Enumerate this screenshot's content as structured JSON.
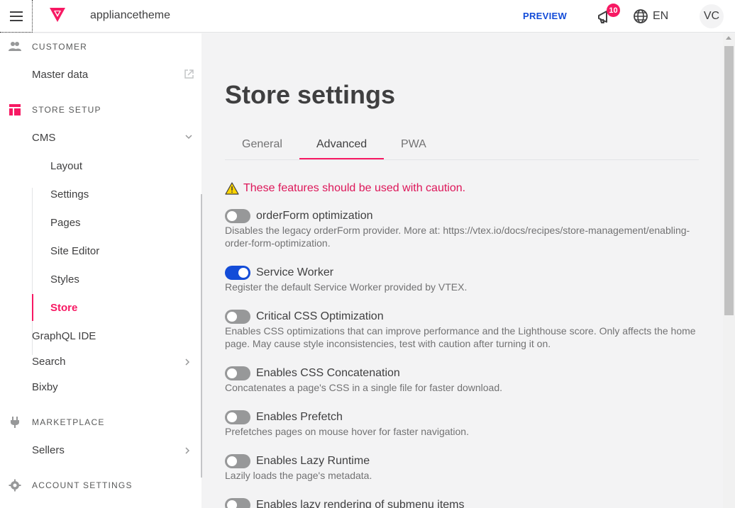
{
  "header": {
    "account_name": "appliancetheme",
    "preview_label": "PREVIEW",
    "notifications_count": "10",
    "language": "EN",
    "user_initials": "VC",
    "brand_color": "#f71963"
  },
  "sidebar": {
    "sections": {
      "customer": {
        "label": "CUSTOMER",
        "icon": "users-icon"
      },
      "store_setup": {
        "label": "STORE SETUP",
        "icon": "layout-icon"
      },
      "marketplace": {
        "label": "MARKETPLACE",
        "icon": "plug-icon"
      },
      "account_settings": {
        "label": "ACCOUNT SETTINGS",
        "icon": "gear-icon"
      }
    },
    "items": {
      "master_data": "Master data",
      "cms": "CMS",
      "graphql_ide": "GraphQL IDE",
      "search": "Search",
      "bixby": "Bixby",
      "sellers": "Sellers"
    },
    "cms_sub_items": [
      "Layout",
      "Settings",
      "Pages",
      "Site Editor",
      "Styles",
      "Store"
    ],
    "active_item": "Store"
  },
  "main": {
    "title": "Store settings",
    "tabs": [
      "General",
      "Advanced",
      "PWA"
    ],
    "active_tab": "Advanced",
    "warning": "These features should be used with caution.",
    "options": [
      {
        "title": "orderForm optimization",
        "enabled": false,
        "description": "Disables the legacy orderForm provider. More at: https://vtex.io/docs/recipes/store-management/enabling-order-form-optimization."
      },
      {
        "title": "Service Worker",
        "enabled": true,
        "description": "Register the default Service Worker provided by VTEX."
      },
      {
        "title": "Critical CSS Optimization",
        "enabled": false,
        "description": "Enables CSS optimizations that can improve performance and the Lighthouse score. Only affects the home page. May cause style inconsistencies, test with caution after turning it on."
      },
      {
        "title": "Enables CSS Concatenation",
        "enabled": false,
        "description": "Concatenates a page's CSS in a single file for faster download."
      },
      {
        "title": "Enables Prefetch",
        "enabled": false,
        "description": "Prefetches pages on mouse hover for faster navigation."
      },
      {
        "title": "Enables Lazy Runtime",
        "enabled": false,
        "description": "Lazily loads the page's metadata."
      },
      {
        "title": "Enables lazy rendering of submenu items",
        "enabled": false,
        "description": ""
      }
    ]
  }
}
